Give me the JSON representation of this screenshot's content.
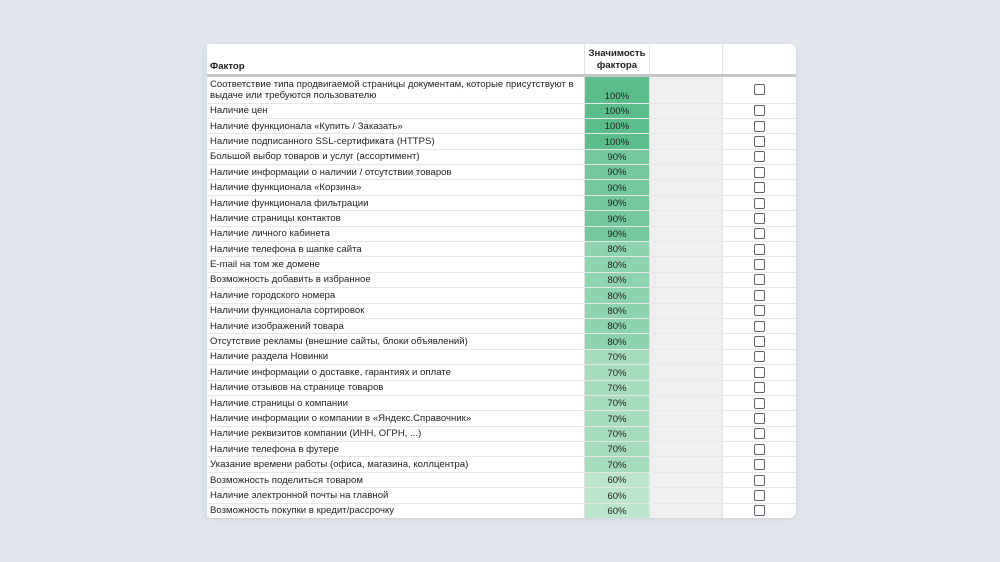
{
  "header": {
    "factor_label": "Фактор",
    "importance_label": "Значимость фактора"
  },
  "colors": {
    "background": "#e1e6ec",
    "p100": "#5bbd8a",
    "p90": "#74c89b",
    "p80": "#8fd3ae",
    "p70": "#a5dcbc",
    "p60": "#bce6cc"
  },
  "rows": [
    {
      "factor": "Соответствие типа продвигаемой страницы документам, которые присутствуют в выдаче или требуются пользователю",
      "value": "100%",
      "pct": 100,
      "checked": false
    },
    {
      "factor": "Наличие цен",
      "value": "100%",
      "pct": 100,
      "checked": false
    },
    {
      "factor": "Наличие функционала «Купить / Заказать»",
      "value": "100%",
      "pct": 100,
      "checked": false
    },
    {
      "factor": "Наличие подписанного SSL-сертификата (HTTPS)",
      "value": "100%",
      "pct": 100,
      "checked": false
    },
    {
      "factor": "Большой выбор товаров и услуг (ассортимент)",
      "value": "90%",
      "pct": 90,
      "checked": false
    },
    {
      "factor": "Наличие информации о наличии / отсутствии товаров",
      "value": "90%",
      "pct": 90,
      "checked": false
    },
    {
      "factor": "Наличие функционала «Корзина»",
      "value": "90%",
      "pct": 90,
      "checked": false
    },
    {
      "factor": "Наличие функционала фильтрации",
      "value": "90%",
      "pct": 90,
      "checked": false
    },
    {
      "factor": "Наличие страницы контактов",
      "value": "90%",
      "pct": 90,
      "checked": false
    },
    {
      "factor": "Наличие личного кабинета",
      "value": "90%",
      "pct": 90,
      "checked": false
    },
    {
      "factor": "Наличие телефона в шапке сайта",
      "value": "80%",
      "pct": 80,
      "checked": false
    },
    {
      "factor": "E-mail на том же домене",
      "value": "80%",
      "pct": 80,
      "checked": false
    },
    {
      "factor": "Возможность добавить в избранное",
      "value": "80%",
      "pct": 80,
      "checked": false
    },
    {
      "factor": "Наличие городского номера",
      "value": "80%",
      "pct": 80,
      "checked": false
    },
    {
      "factor": "Наличии функционала сортировок",
      "value": "80%",
      "pct": 80,
      "checked": false
    },
    {
      "factor": "Наличие изображений товара",
      "value": "80%",
      "pct": 80,
      "checked": false
    },
    {
      "factor": "Отсутствие рекламы (внешние сайты, блоки объявлений)",
      "value": "80%",
      "pct": 80,
      "checked": false
    },
    {
      "factor": "Наличие раздела Новинки",
      "value": "70%",
      "pct": 70,
      "checked": false
    },
    {
      "factor": "Наличие информации о доставке, гарантиях и оплате",
      "value": "70%",
      "pct": 70,
      "checked": false
    },
    {
      "factor": "Наличие отзывов на странице товаров",
      "value": "70%",
      "pct": 70,
      "checked": false
    },
    {
      "factor": "Наличие страницы о компании",
      "value": "70%",
      "pct": 70,
      "checked": false
    },
    {
      "factor": "Наличие информации о компании в «Яндекс.Справочник»",
      "value": "70%",
      "pct": 70,
      "checked": false
    },
    {
      "factor": "Наличие реквизитов компании (ИНН, ОГРН, ...)",
      "value": "70%",
      "pct": 70,
      "checked": false
    },
    {
      "factor": "Наличие телефона в футере",
      "value": "70%",
      "pct": 70,
      "checked": false
    },
    {
      "factor": "Указание времени работы (офиса, магазина, коллцентра)",
      "value": "70%",
      "pct": 70,
      "checked": false
    },
    {
      "factor": "Возможность поделиться товаром",
      "value": "60%",
      "pct": 60,
      "checked": false
    },
    {
      "factor": "Наличие электронной почты на главной",
      "value": "60%",
      "pct": 60,
      "checked": false
    },
    {
      "factor": "Возможность покупки в кредит/рассрочку",
      "value": "60%",
      "pct": 60,
      "checked": false
    }
  ]
}
